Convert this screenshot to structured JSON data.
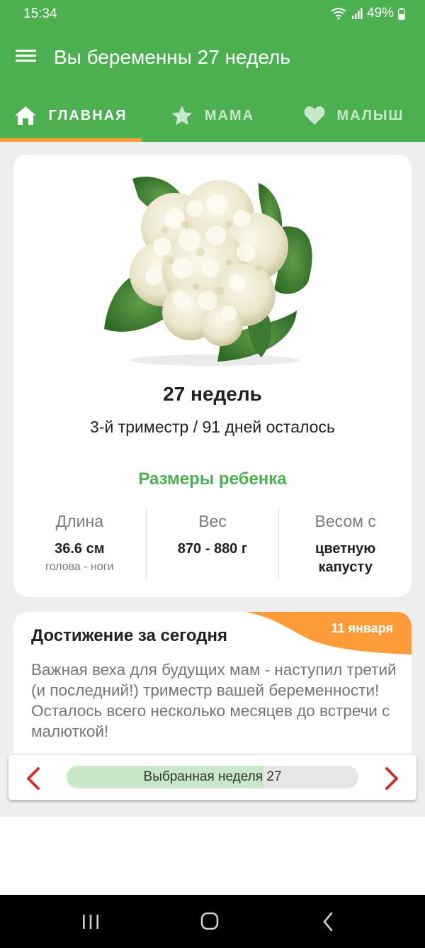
{
  "status": {
    "time": "15:34",
    "battery": "49%"
  },
  "app_bar": {
    "title": "Вы беременны 27 недель"
  },
  "tabs": [
    {
      "label": "ГЛАВНАЯ",
      "icon": "home-icon",
      "active": true
    },
    {
      "label": "МАМА",
      "icon": "star-icon",
      "active": false
    },
    {
      "label": "МАЛЫШ",
      "icon": "heart-icon",
      "active": false
    }
  ],
  "main": {
    "image": "cauliflower",
    "weeks": "27 недель",
    "trimester": "3-й триместр / 91 дней осталось",
    "sizes_title": "Размеры ребенка",
    "metrics": [
      {
        "label": "Длина",
        "value": "36.6 см",
        "sub": "голова - ноги"
      },
      {
        "label": "Вес",
        "value": "870 - 880 г",
        "sub": ""
      },
      {
        "label": "Весом с",
        "value": "цветную капусту",
        "sub": ""
      }
    ]
  },
  "achievement": {
    "title": "Достижение за сегодня",
    "date": "11 января",
    "text": "Важная веха для будущих мам - наступил третий (и последний!) триместр вашей беременности! Осталось всего несколько месяцев до встречи с малюткой!"
  },
  "week_selector": {
    "label": "Выбранная неделя 27",
    "progress": 0.675
  },
  "colors": {
    "primary": "#4caf50",
    "accent": "#ff9c3a",
    "arrow": "#d32f2f"
  }
}
